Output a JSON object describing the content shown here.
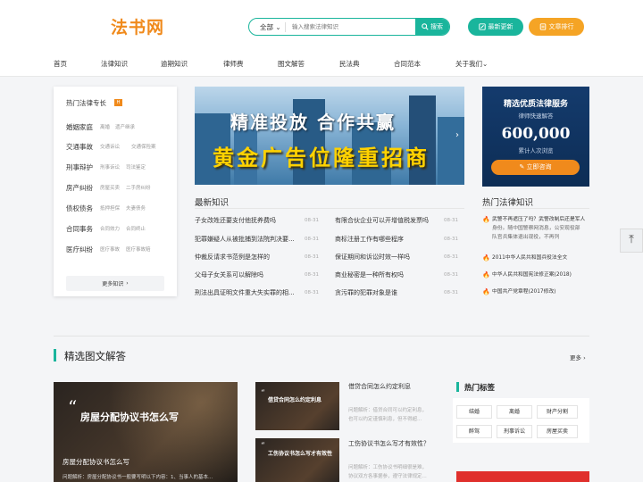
{
  "header": {
    "logo": "法书网",
    "search": {
      "category": "全部",
      "placeholder": "输入搜索法律知识",
      "button": "搜索"
    },
    "update_button": "最新更新",
    "rank_button": "文章排行"
  },
  "nav": [
    "首页",
    "法律知识",
    "逾期知识",
    "律师费",
    "图文解答",
    "民法典",
    "合同范本",
    "关于我们"
  ],
  "specialty": {
    "title": "热门法律专长",
    "badge": "H",
    "rows": [
      {
        "cat": "婚姻家庭",
        "tags": [
          "离婚",
          "遗产继承"
        ]
      },
      {
        "cat": "交通事故",
        "tags": [
          "交通诉讼",
          "交通保险案"
        ]
      },
      {
        "cat": "刑事辩护",
        "tags": [
          "刑事诉讼",
          "司法鉴定"
        ]
      },
      {
        "cat": "房产纠纷",
        "tags": [
          "房屋买卖",
          "二手房纠纷"
        ]
      },
      {
        "cat": "债权债务",
        "tags": [
          "抵押担保",
          "夫妻债务"
        ]
      },
      {
        "cat": "合同事务",
        "tags": [
          "合同效力",
          "合同终止"
        ]
      },
      {
        "cat": "医疗纠纷",
        "tags": [
          "医疗事故",
          "医疗事故赔"
        ]
      }
    ],
    "more": "更多知识"
  },
  "banner": {
    "line1": "精准投放  合作共赢",
    "line2": "黄金广告位隆重招商"
  },
  "ad": {
    "title": "精选优质法律服务",
    "subtitle": "律师快速解答",
    "number": "600,000",
    "unit": "累计人次浏览",
    "button": "立即咨询"
  },
  "latest": {
    "title": "最新知识",
    "left": [
      {
        "text": "子女改姓还要支付他抚养费吗",
        "date": "08-31"
      },
      {
        "text": "犯罪嫌疑人从被批捕到法院判决要...",
        "date": "08-31"
      },
      {
        "text": "仲裁反请求书范例是怎样的",
        "date": "08-31"
      },
      {
        "text": "父母子女关系可以解除吗",
        "date": "08-31"
      },
      {
        "text": "刑法出具证明文件重大失实罪的相...",
        "date": "08-31"
      }
    ],
    "right": [
      {
        "text": "有限合伙企业可以开增值税发票吗",
        "date": "08-31"
      },
      {
        "text": "商标注册工作有哪些程序",
        "date": "08-31"
      },
      {
        "text": "保证期间和诉讼时效一样吗",
        "date": "08-31"
      },
      {
        "text": "商业秘密是一种所有权吗",
        "date": "08-31"
      },
      {
        "text": "贪污罪的犯罪对象是谁",
        "date": "08-31"
      }
    ]
  },
  "hot_laws": {
    "title": "热门法律知识",
    "items": [
      {
        "line1": "武警不再遮压了吗？武警改制后还是军人",
        "line2": "身份。随中国警察网消息，公安现役部",
        "line3": "队官兵集体退出现役，不再列"
      },
      {
        "line1": "2011中华人民共和国兵役法全文",
        "line2": "",
        "line3": ""
      },
      {
        "line1": "中华人民共和国宪法修正案(2018)",
        "line2": "",
        "line3": ""
      },
      {
        "line1": "中国共产党章程(2017修改)",
        "line2": "",
        "line3": ""
      }
    ]
  },
  "featured_section": {
    "title": "精选图文解答",
    "more": "更多"
  },
  "featured": {
    "image_text": "房屋分配协议书怎么写",
    "caption": "房屋分配协议书怎么写",
    "desc": "问题解析：房屋分配协议书一般要写明以下内容：1、当事人的基本..."
  },
  "articles": [
    {
      "thumb_text": "借贷合同怎么约定利息",
      "title": "借贷合同怎么约定利息",
      "desc1": "问题解析：借贷合同可以约定利息，",
      "desc2": "也可以约定谨慎利息，但不得超..."
    },
    {
      "thumb_text": "工伤协议书怎么写才有效性",
      "title": "工伤协议书怎么写才有效性？",
      "desc1": "问题解析：工伤协议书明细很是难，",
      "desc2": "协议双方各事据参，遵守法律规定..."
    }
  ],
  "hot_tags": {
    "title": "热门标签",
    "tags": [
      "结婚",
      "离婚",
      "财产分割",
      "醉驾",
      "刑事诉讼",
      "房屋买卖"
    ]
  }
}
